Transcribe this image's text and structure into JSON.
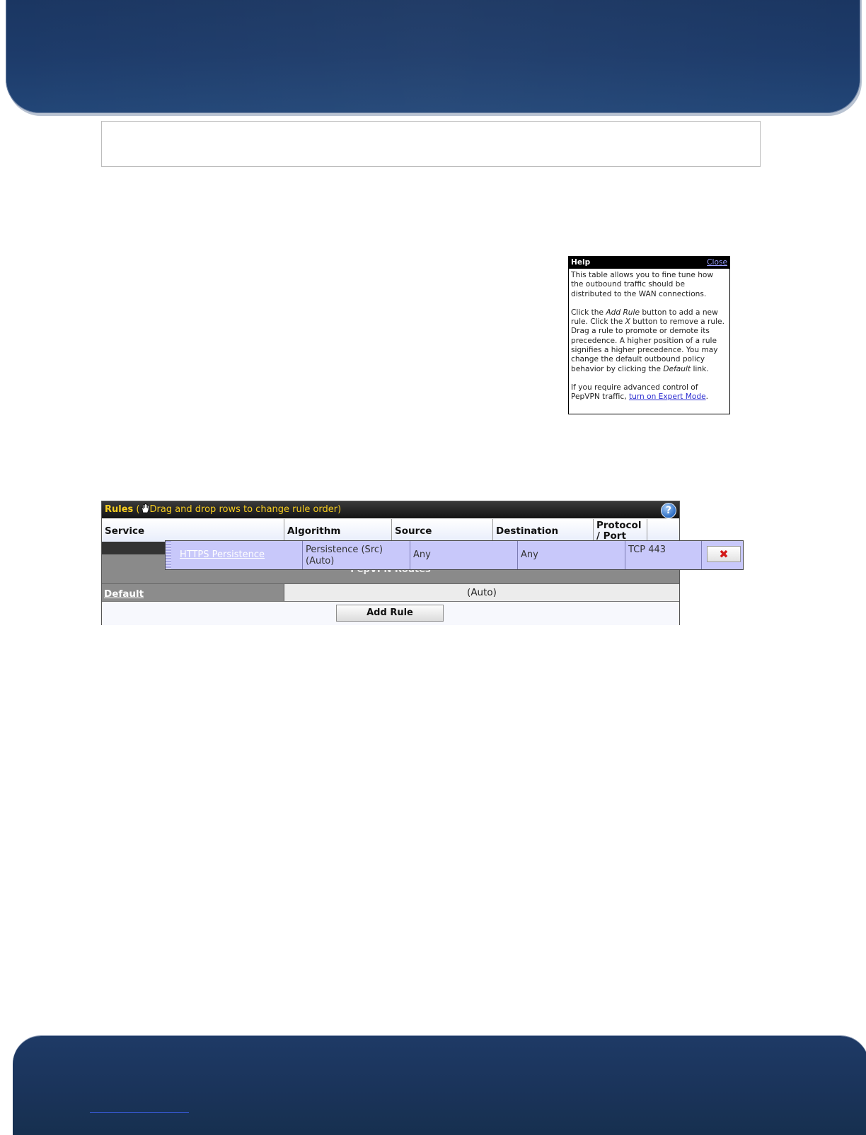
{
  "help": {
    "title": "Help",
    "close_label": "Close",
    "para1": "This table allows you to fine tune how the outbound traffic should be distributed to the WAN connections.",
    "para2_a": "Click the ",
    "para2_add": "Add Rule",
    "para2_b": " button to add a new rule. Click the ",
    "para2_x": "X",
    "para2_c": " button to remove a rule. Drag a rule to promote or demote its precedence. A higher position of a rule signifies a higher precedence. You may change the default outbound policy behavior by clicking the ",
    "para2_default": "Default",
    "para2_d": " link.",
    "para3_a": "If you require advanced control of PepVPN traffic, ",
    "para3_link": "turn on Expert Mode",
    "para3_b": "."
  },
  "rules": {
    "title": "Rules",
    "title_open": " (",
    "drag_hint": "Drag and drop rows to change rule order)",
    "help_icon": "?",
    "columns": [
      "Service",
      "Algorithm",
      "Source",
      "Destination",
      "Protocol / Port"
    ],
    "dragged_row": {
      "service": "HTTPS Persistence",
      "algorithm": "Persistence (Src) (Auto)",
      "source": "Any",
      "destination": "Any",
      "protocol": "TCP 443",
      "delete_icon": "✖"
    },
    "section_label": "PepVPN Routes",
    "default_link": "Default",
    "default_value": "(Auto)",
    "add_button": "Add Rule"
  },
  "icons": {
    "hand": "hand-drag-icon",
    "help": "question-circle-icon",
    "delete": "red-x-icon"
  },
  "colors": {
    "banner": "#1d3b6a",
    "rules_title_text": "#f7cd20",
    "drag_row_bg": "#c8c8fa",
    "delete_x": "#d31a1a"
  }
}
